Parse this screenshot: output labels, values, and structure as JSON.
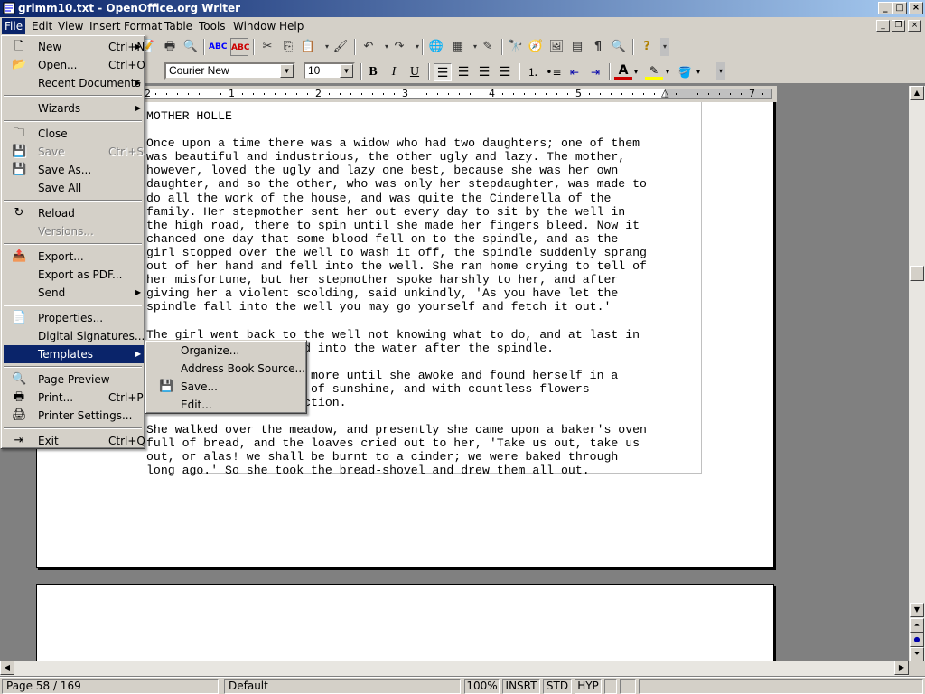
{
  "window": {
    "title": "grimm10.txt - OpenOffice.org Writer",
    "min_label": "_",
    "max_label": "□",
    "close_label": "×"
  },
  "menubar": [
    "File",
    "Edit",
    "View",
    "Insert",
    "Format",
    "Table",
    "Tools",
    "Window",
    "Help"
  ],
  "toolbar2": {
    "font_name": "Courier New",
    "font_size": "10",
    "bold": "B",
    "italic": "I",
    "underline": "U"
  },
  "ruler": [
    "1",
    "2",
    "3",
    "4",
    "5",
    "6",
    "7"
  ],
  "file_menu": [
    {
      "label": "New",
      "accel": "Ctrl+N",
      "icon": "new-document-icon",
      "glyph": "🗋",
      "submenu": true
    },
    {
      "label": "Open...",
      "accel": "Ctrl+O",
      "icon": "open-folder-icon",
      "glyph": "📂"
    },
    {
      "label": "Recent Documents",
      "accel": "",
      "icon": "",
      "glyph": "",
      "submenu": true
    },
    {
      "sep": true
    },
    {
      "label": "Wizards",
      "accel": "",
      "icon": "",
      "glyph": "",
      "submenu": true
    },
    {
      "sep": true
    },
    {
      "label": "Close",
      "accel": "",
      "icon": "close-document-icon",
      "glyph": "🗀"
    },
    {
      "label": "Save",
      "accel": "Ctrl+S",
      "icon": "save-icon",
      "glyph": "💾",
      "disabled": true
    },
    {
      "label": "Save As...",
      "accel": "",
      "icon": "save-as-icon",
      "glyph": "💾"
    },
    {
      "label": "Save All",
      "accel": "",
      "icon": "",
      "glyph": ""
    },
    {
      "sep": true
    },
    {
      "label": "Reload",
      "accel": "",
      "icon": "reload-icon",
      "glyph": "↻"
    },
    {
      "label": "Versions...",
      "accel": "",
      "icon": "",
      "glyph": "",
      "disabled": true
    },
    {
      "sep": true
    },
    {
      "label": "Export...",
      "accel": "",
      "icon": "export-icon",
      "glyph": "📤"
    },
    {
      "label": "Export as PDF...",
      "accel": "",
      "icon": "",
      "glyph": ""
    },
    {
      "label": "Send",
      "accel": "",
      "icon": "",
      "glyph": "",
      "submenu": true
    },
    {
      "sep": true
    },
    {
      "label": "Properties...",
      "accel": "",
      "icon": "properties-icon",
      "glyph": "📄"
    },
    {
      "label": "Digital Signatures...",
      "accel": "",
      "icon": "",
      "glyph": ""
    },
    {
      "label": "Templates",
      "accel": "",
      "icon": "",
      "glyph": "",
      "submenu": true,
      "highlight": true
    },
    {
      "sep": true
    },
    {
      "label": "Page Preview",
      "accel": "",
      "icon": "page-preview-icon",
      "glyph": "🔍"
    },
    {
      "label": "Print...",
      "accel": "Ctrl+P",
      "icon": "print-icon",
      "glyph": "🖶"
    },
    {
      "label": "Printer Settings...",
      "accel": "",
      "icon": "printer-settings-icon",
      "glyph": "🖨"
    },
    {
      "sep": true
    },
    {
      "label": "Exit",
      "accel": "Ctrl+Q",
      "icon": "exit-icon",
      "glyph": "⇥"
    }
  ],
  "templates_menu": [
    {
      "label": "Organize...",
      "icon": "",
      "glyph": ""
    },
    {
      "label": "Address Book Source...",
      "icon": "",
      "glyph": ""
    },
    {
      "label": "Save...",
      "icon": "save-template-icon",
      "glyph": "💾"
    },
    {
      "label": "Edit...",
      "icon": "",
      "glyph": ""
    }
  ],
  "document": {
    "text": "MOTHER HOLLE\n\nOnce upon a time there was a widow who had two daughters; one of them\nwas beautiful and industrious, the other ugly and lazy. The mother,\nhowever, loved the ugly and lazy one best, because she was her own\ndaughter, and so the other, who was only her stepdaughter, was made to\ndo all the work of the house, and was quite the Cinderella of the\nfamily. Her stepmother sent her out every day to sit by the well in\nthe high road, there to spin until she made her fingers bleed. Now it\nchanced one day that some blood fell on to the spindle, and as the\ngirl stopped over the well to wash it off, the spindle suddenly sprang\nout of her hand and fell into the well. She ran home crying to tell of\nher misfortune, but her stepmother spoke harshly to her, and after\ngiving her a violent scolding, said unkindly, 'As you have let the\nspindle fall into the well you may go yourself and fetch it out.'\n\nThe girl went back to the well not knowing what to do, and at last in\nher distress she jumped into the water after the spindle.\n\nShe remembered nothing more until she awoke and found herself in a\nbeautiful meadow, full of sunshine, and with countless flowers\nblooming in every direction.\n\nShe walked over the meadow, and presently she came upon a baker's oven\nfull of bread, and the loaves cried out to her, 'Take us out, take us\nout, or alas! we shall be burnt to a cinder; we were baked through\nlong ago.' So she took the bread-shovel and drew them all out."
  },
  "status": {
    "page": "Page 58 / 169",
    "style": "Default",
    "zoom": "100%",
    "insert": "INSRT",
    "select": "STD",
    "hyp": "HYP"
  },
  "colors": {
    "title_start": "#0a246a",
    "title_end": "#a6caf0",
    "menu_highlight": "#0a246a",
    "face": "#d4d0c8",
    "workspace": "#808080"
  }
}
